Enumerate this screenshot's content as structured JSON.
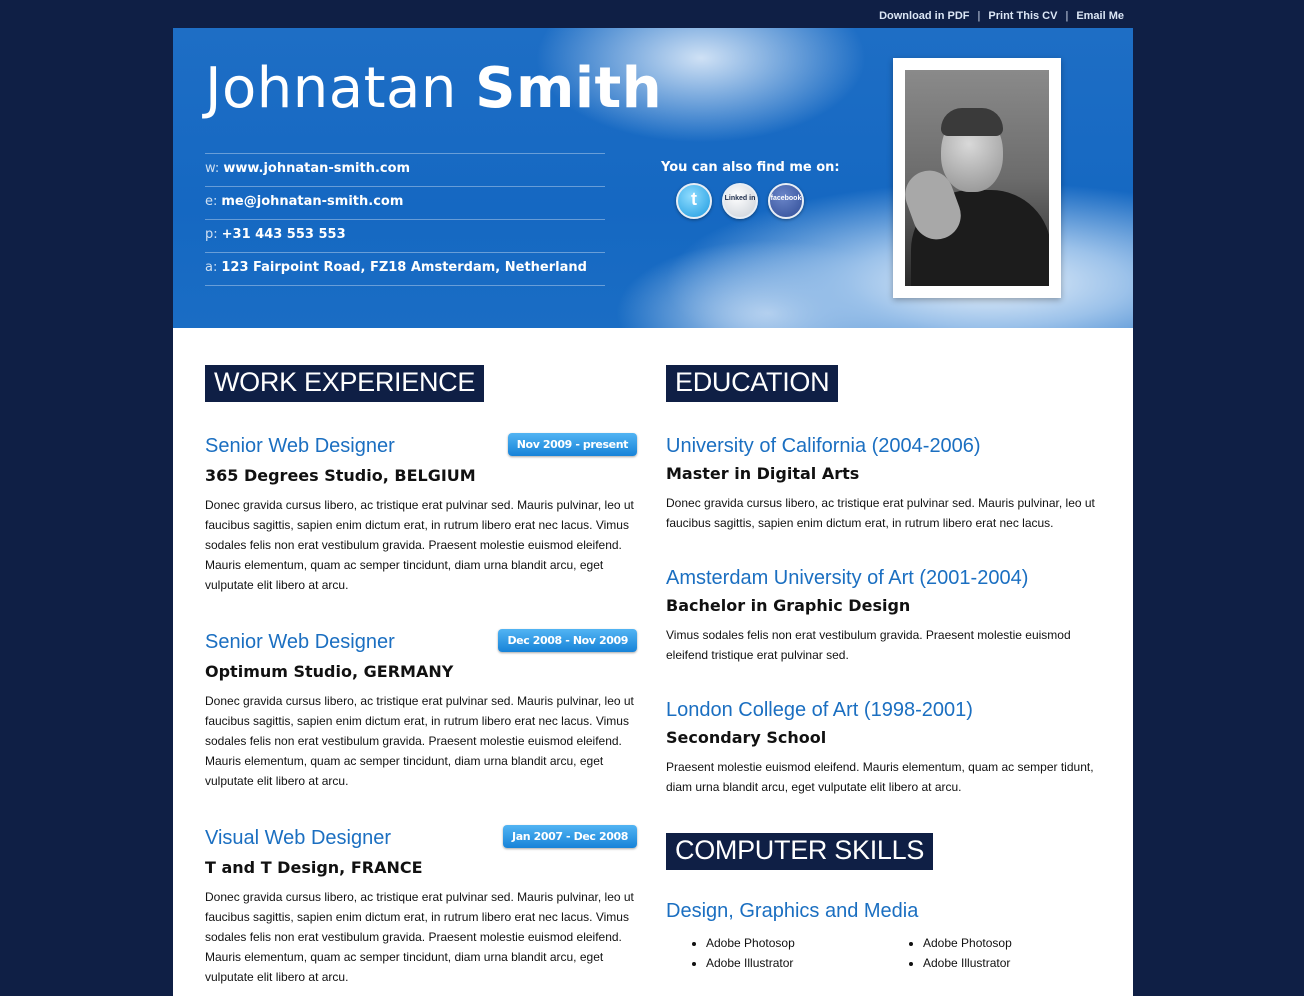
{
  "top_links": [
    "Download in PDF",
    "Print This CV",
    "Email Me"
  ],
  "header": {
    "first_name": "Johnatan",
    "last_name": "Smith",
    "contact": [
      {
        "key": "w:",
        "value": "www.johnatan-smith.com"
      },
      {
        "key": "e:",
        "value": "me@johnatan-smith.com"
      },
      {
        "key": "p:",
        "value": "+31 443 553 553"
      },
      {
        "key": "a:",
        "value": "123 Fairpoint Road, FZ18 Amsterdam, Netherland"
      }
    ],
    "social_title": "You can also find me on:",
    "social": {
      "twitter": "t",
      "linkedin": "Linked in",
      "facebook": "facebook"
    }
  },
  "work": {
    "title": "WORK EXPERIENCE",
    "jobs": [
      {
        "title": "Senior Web Designer",
        "company": "365 Degrees Studio, BELGIUM",
        "date": "Nov 2009 - present",
        "desc": "Donec gravida cursus libero, ac tristique erat pulvinar sed. Mauris pulvinar, leo ut faucibus sagittis, sapien enim dictum erat, in rutrum libero erat nec lacus. Vimus sodales felis non erat vestibulum gravida. Praesent molestie euismod eleifend. Mauris elementum, quam ac semper tincidunt, diam urna blandit arcu, eget vulputate elit libero at arcu."
      },
      {
        "title": "Senior Web Designer",
        "company": "Optimum Studio, GERMANY",
        "date": "Dec 2008 - Nov 2009",
        "desc": "Donec gravida cursus libero, ac tristique erat pulvinar sed. Mauris pulvinar, leo ut faucibus sagittis, sapien enim dictum erat, in rutrum libero erat nec lacus. Vimus sodales felis non erat vestibulum gravida. Praesent molestie euismod eleifend. Mauris elementum, quam ac semper tincidunt, diam urna blandit arcu, eget vulputate elit libero at arcu."
      },
      {
        "title": "Visual Web Designer",
        "company": "T and T Design, FRANCE",
        "date": "Jan 2007 - Dec 2008",
        "desc": "Donec gravida cursus libero, ac tristique erat pulvinar sed. Mauris pulvinar, leo ut faucibus sagittis, sapien enim dictum erat, in rutrum libero erat nec lacus. Vimus sodales felis non erat vestibulum gravida. Praesent molestie euismod eleifend. Mauris elementum, quam ac semper tincidunt, diam urna blandit arcu, eget vulputate elit libero at arcu."
      }
    ]
  },
  "education": {
    "title": "EDUCATION",
    "items": [
      {
        "school": "University of California (2004-2006)",
        "degree": "Master in Digital Arts",
        "desc": "Donec gravida cursus libero, ac tristique erat pulvinar sed. Mauris pulvinar, leo ut faucibus sagittis, sapien enim dictum erat, in rutrum libero erat nec lacus."
      },
      {
        "school": "Amsterdam University of Art (2001-2004)",
        "degree": "Bachelor in Graphic Design",
        "desc": "Vimus sodales felis non erat vestibulum gravida. Praesent molestie euismod eleifend tristique erat pulvinar sed."
      },
      {
        "school": "London College of Art (1998-2001)",
        "degree": "Secondary School",
        "desc": "Praesent molestie euismod eleifend. Mauris elementum, quam ac semper tidunt, diam urna blandit arcu, eget vulputate elit libero at arcu."
      }
    ]
  },
  "skills": {
    "title": "COMPUTER SKILLS",
    "subtitle": "Design, Graphics and Media",
    "col1": [
      "Adobe Photosop",
      "Adobe Illustrator"
    ],
    "col2": [
      "Adobe Photosop",
      "Adobe Illustrator"
    ]
  },
  "colors": {
    "page_bg": "#0f1f45",
    "accent": "#1b6fc1",
    "header_blue": "#1a6dc4"
  }
}
